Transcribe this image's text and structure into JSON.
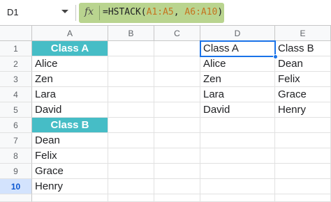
{
  "namebox": {
    "value": "D1"
  },
  "formula": {
    "fx_label": "fx",
    "prefix": "=HSTACK(",
    "ref1": "A1:A5",
    "sep": ", ",
    "ref2": "A6:A10",
    "suffix": ")"
  },
  "columns": [
    "A",
    "B",
    "C",
    "D",
    "E"
  ],
  "rows": [
    "1",
    "2",
    "3",
    "4",
    "5",
    "6",
    "7",
    "8",
    "9",
    "10"
  ],
  "cells": {
    "A": [
      "Class A",
      "Alice",
      "Zen",
      "Lara",
      "David",
      "Class B",
      "Dean",
      "Felix",
      "Grace",
      "Henry"
    ],
    "D": [
      "Class A",
      "Alice",
      "Zen",
      "Lara",
      "David"
    ],
    "E": [
      "Class B",
      "Dean",
      "Felix",
      "Grace",
      "Henry"
    ]
  },
  "colors": {
    "header_fill": "#46bdc6",
    "formula_bar_highlight": "#b9d48f",
    "selection": "#1a73e8"
  }
}
